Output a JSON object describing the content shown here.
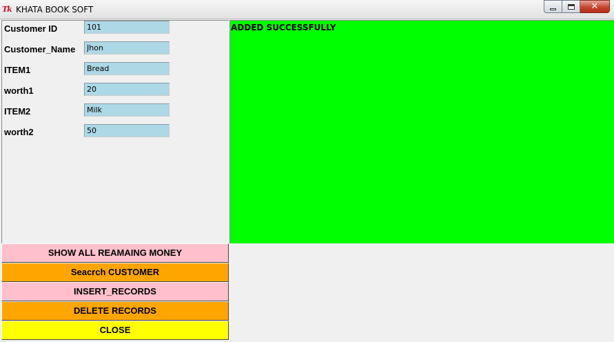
{
  "window": {
    "title": "KHATA BOOK SOFT",
    "icon_text": "Tk",
    "close_glyph": "✕"
  },
  "form": {
    "fields": [
      {
        "label": "Customer ID",
        "value": "101"
      },
      {
        "label": "Customer_Name",
        "value": "Jhon"
      },
      {
        "label": "ITEM1",
        "value": "Bread"
      },
      {
        "label": "worth1",
        "value": "20"
      },
      {
        "label": "ITEM2",
        "value": "Milk"
      },
      {
        "label": "worth2",
        "value": "50"
      }
    ]
  },
  "output": {
    "message": "ADDED SUCCESSFULLY",
    "background": "#00ff00"
  },
  "buttons": [
    {
      "label": "SHOW ALL REAMAING MONEY",
      "color": "#ffc0cb"
    },
    {
      "label": "Seacrch CUSTOMER",
      "color": "#ffa500"
    },
    {
      "label": "INSERT_RECORDS",
      "color": "#ffc0cb"
    },
    {
      "label": "DELETE RECORDS",
      "color": "#ffa500"
    },
    {
      "label": "CLOSE",
      "color": "#ffff00"
    }
  ]
}
